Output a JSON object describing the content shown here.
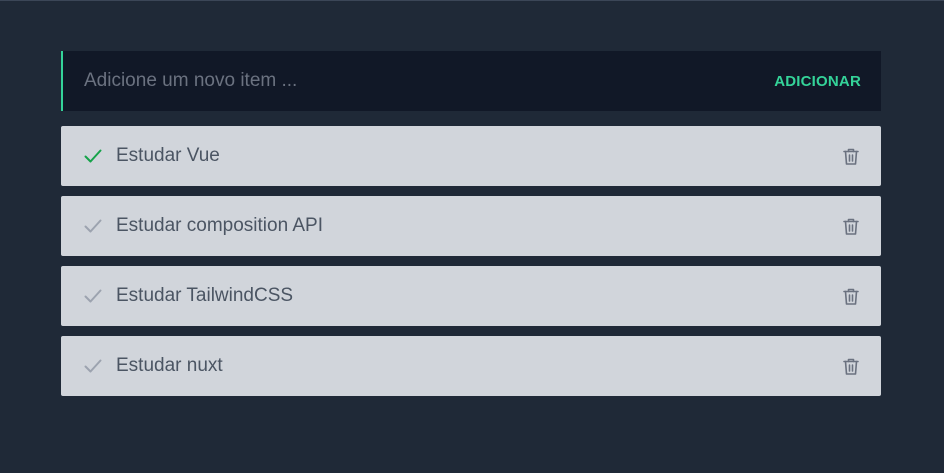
{
  "new_item": {
    "placeholder": "Adicione um novo item ...",
    "value": "",
    "add_label": "ADICIONAR"
  },
  "todos": [
    {
      "text": "Estudar Vue",
      "done": true
    },
    {
      "text": "Estudar composition API",
      "done": false
    },
    {
      "text": "Estudar TailwindCSS",
      "done": false
    },
    {
      "text": "Estudar nuxt",
      "done": false
    }
  ],
  "icons": {
    "check": "check-icon",
    "delete": "trash-icon"
  },
  "colors": {
    "background": "#1f2937",
    "input_background": "#111827",
    "accent": "#34d399",
    "item_background": "#d1d5db",
    "check_done": "#16a34a",
    "check_pending": "#9ca3af",
    "trash": "#6b7280"
  }
}
